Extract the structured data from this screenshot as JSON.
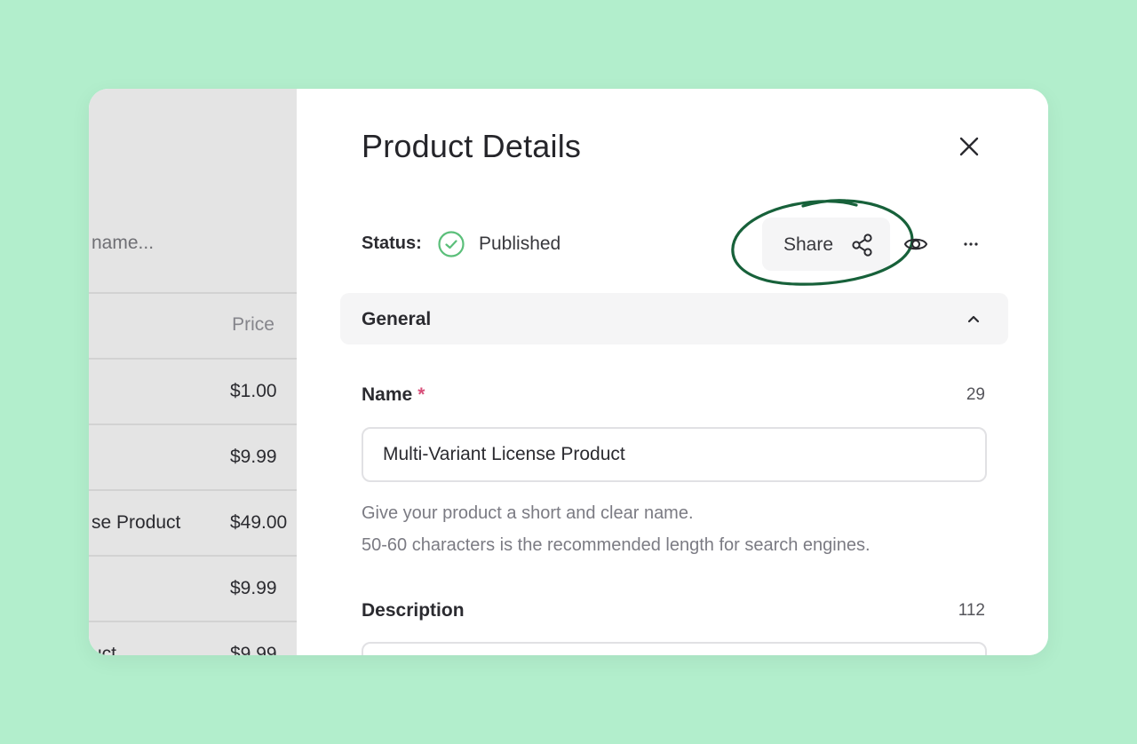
{
  "left_panel": {
    "search_fragment": "name...",
    "column_header": "Price",
    "rows": [
      {
        "name": "",
        "price": "$1.00"
      },
      {
        "name": "",
        "price": "$9.99"
      },
      {
        "name": "se Product",
        "price": "$49.00"
      },
      {
        "name": "",
        "price": "$9.99"
      },
      {
        "name": "uct",
        "price": "$9.99"
      }
    ]
  },
  "drawer": {
    "title": "Product Details",
    "status_label": "Status:",
    "status_value": "Published",
    "share_label": "Share",
    "section_title": "General",
    "name_field": {
      "label": "Name",
      "required_mark": "*",
      "count": "29",
      "value": "Multi-Variant License Product",
      "help_line_1": "Give your product a short and clear name.",
      "help_line_2": "50-60 characters is the recommended length for search engines."
    },
    "description_field": {
      "label": "Description",
      "count": "112"
    }
  },
  "icons": {
    "close": "close-icon",
    "status": "check-circle-icon",
    "share": "share-icon",
    "preview": "eye-icon",
    "more": "more-horizontal-icon",
    "collapse": "chevron-up-icon"
  },
  "colors": {
    "background": "#b2eecc",
    "status_green": "#5bbf7a",
    "annotation_green": "#17613a",
    "required_red": "#d8507a"
  }
}
